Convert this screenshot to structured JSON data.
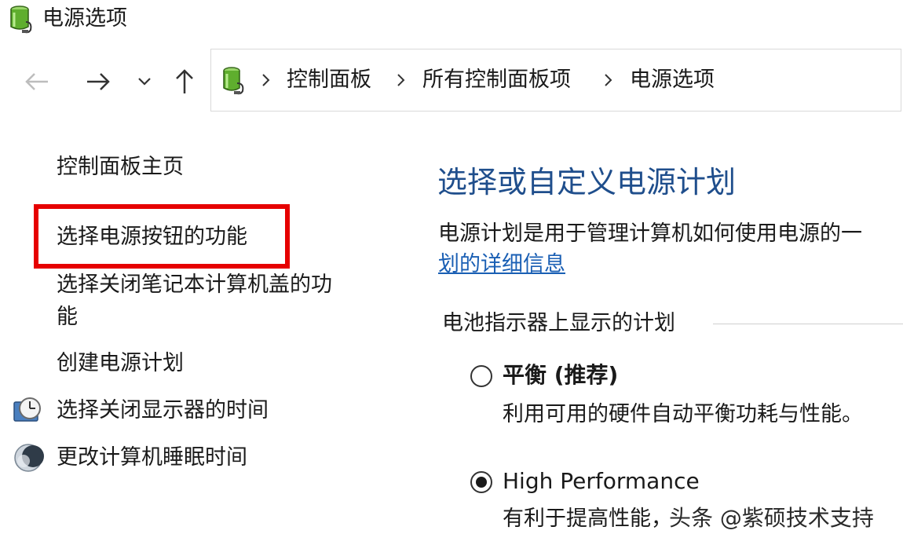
{
  "window": {
    "title": "电源选项",
    "icon": "power-options-battery-icon"
  },
  "nav": {
    "back_icon": "arrow-left-icon",
    "forward_icon": "arrow-right-icon",
    "recent_icon": "chevron-down-icon",
    "up_icon": "arrow-up-icon"
  },
  "breadcrumb": {
    "items": [
      "控制面板",
      "所有控制面板项",
      "电源选项"
    ],
    "separator_icon": "chevron-right-icon"
  },
  "sidebar": {
    "home_label": "控制面板主页",
    "items": [
      {
        "label": "选择电源按钮的功能",
        "highlighted": true
      },
      {
        "label_line1": "选择关闭笔记本计算机盖的功",
        "label_line2": "能"
      },
      {
        "label": "创建电源计划"
      },
      {
        "label": "选择关闭显示器的时间",
        "icon": "display-clock-icon"
      },
      {
        "label": "更改计算机睡眠时间",
        "icon": "moon-sleep-icon"
      }
    ],
    "highlight_color": "#e60000"
  },
  "main": {
    "heading": "选择或自定义电源计划",
    "description": "电源计划是用于管理计算机如何使用电源的一",
    "link_text": "划的详细信息",
    "group_label": "电池指示器上显示的计划",
    "plans": [
      {
        "name": "平衡 (推荐)",
        "description": "利用可用的硬件自动平衡功耗与性能。",
        "selected": false
      },
      {
        "name": "High Performance",
        "description": "有利于提高性能，",
        "selected": true
      }
    ],
    "heading_color": "#1f4e8c",
    "link_color": "#1a5fb4"
  },
  "watermark": "头条 @紫硕技术支持"
}
